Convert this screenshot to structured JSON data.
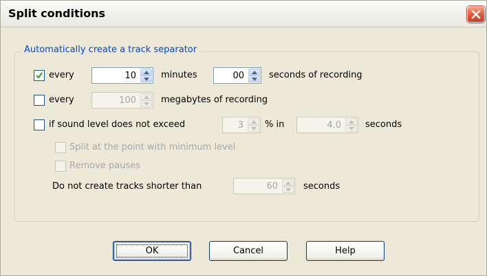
{
  "window": {
    "title": "Split conditions"
  },
  "group": {
    "label": "Automatically create a track separator"
  },
  "rows": {
    "minutes": {
      "checked": true,
      "label": "every",
      "minutes_value": "10",
      "minutes_label": "minutes",
      "seconds_value": "00",
      "seconds_label": "seconds of recording"
    },
    "megabytes": {
      "checked": false,
      "label": "every",
      "value": "100",
      "unit_label": "megabytes of recording"
    },
    "sound_level": {
      "checked": false,
      "label": "if sound level does not exceed",
      "percent_value": "3",
      "percent_label": "% in",
      "seconds_value": "4.0",
      "seconds_label": "seconds"
    },
    "split_min": {
      "checked": false,
      "label": "Split at the point with minimum level"
    },
    "remove_pauses": {
      "checked": false,
      "label": "Remove pauses"
    },
    "min_track": {
      "label": "Do not create tracks shorter than",
      "value": "60",
      "unit_label": "seconds"
    }
  },
  "buttons": {
    "ok": "OK",
    "cancel": "Cancel",
    "help": "Help"
  },
  "icons": {
    "close": "close-icon",
    "check": "check-icon",
    "spin_up": "up-arrow-icon",
    "spin_down": "down-arrow-icon"
  },
  "colors": {
    "accent": "#0046d5",
    "check": "#21a121",
    "close": "#e05a3b",
    "disabled_text": "#a7a6aa"
  }
}
